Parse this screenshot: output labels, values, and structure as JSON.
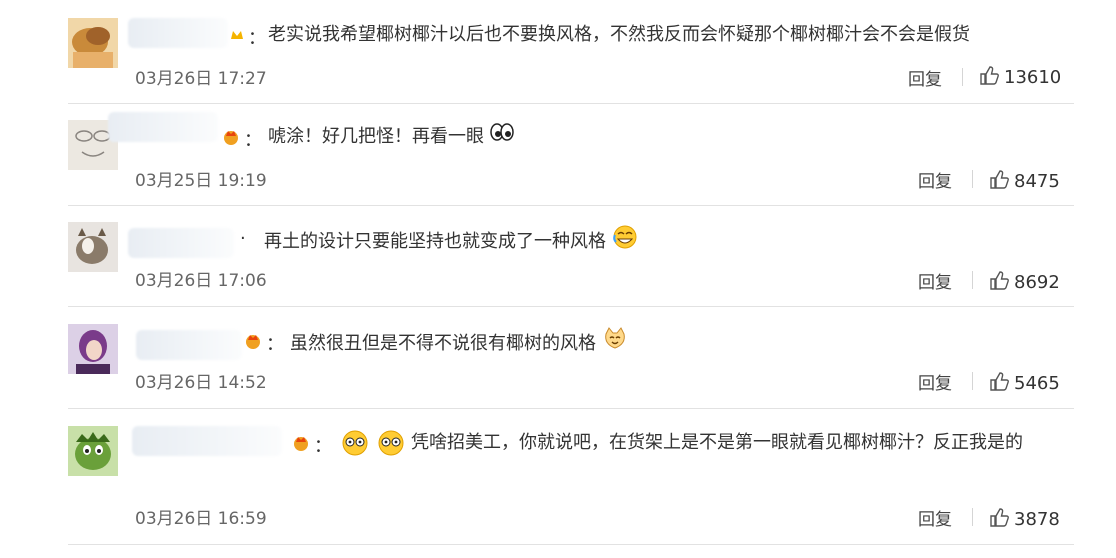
{
  "comments": [
    {
      "text": "老实说我希望椰树椰汁以后也不要换风格，不然我反而会怀疑那个椰树椰汁会不会是假货",
      "date": "03月26日 17:27",
      "reply_label": "回复",
      "likes": "13610",
      "avatar_icon": "avatar-icon",
      "colors": {
        "avatar": "#c98a3a"
      }
    },
    {
      "text": "唬涂！好几把怪！再看一眼",
      "date": "03月25日 19:19",
      "reply_label": "回复",
      "likes": "8475",
      "avatar_icon": "avatar-icon",
      "colors": {
        "avatar": "#d9d4cc"
      }
    },
    {
      "text": "再土的设计只要能坚持也就变成了一种风格",
      "date": "03月26日 17:06",
      "reply_label": "回复",
      "likes": "8692",
      "avatar_icon": "avatar-icon",
      "colors": {
        "avatar": "#8a7b6a"
      }
    },
    {
      "text": "虽然很丑但是不得不说很有椰树的风格",
      "date": "03月26日 14:52",
      "reply_label": "回复",
      "likes": "5465",
      "avatar_icon": "avatar-icon",
      "colors": {
        "avatar": "#7a3b8a"
      }
    },
    {
      "text": "凭啥招美工，你就说吧，在货架上是不是第一眼就看见椰树椰汁？反正我是的",
      "date": "03月26日 16:59",
      "reply_label": "回复",
      "likes": "3878",
      "avatar_icon": "avatar-icon",
      "colors": {
        "avatar": "#6aa03a"
      }
    }
  ],
  "icons": {
    "like": "thumbs-up-icon",
    "crown": "crown-icon",
    "emoji_eyes": "eyes-emoji-icon",
    "emoji_laugh_cry": "laugh-cry-emoji-icon",
    "emoji_cat": "cat-emoji-icon",
    "emoji_dizzy": "dizzy-eyes-emoji-icon"
  },
  "colors": {
    "background": "#ffffff",
    "text": "#333333",
    "meta": "#666666",
    "divider": "#e2e2e2",
    "crown": "#f5a623"
  }
}
